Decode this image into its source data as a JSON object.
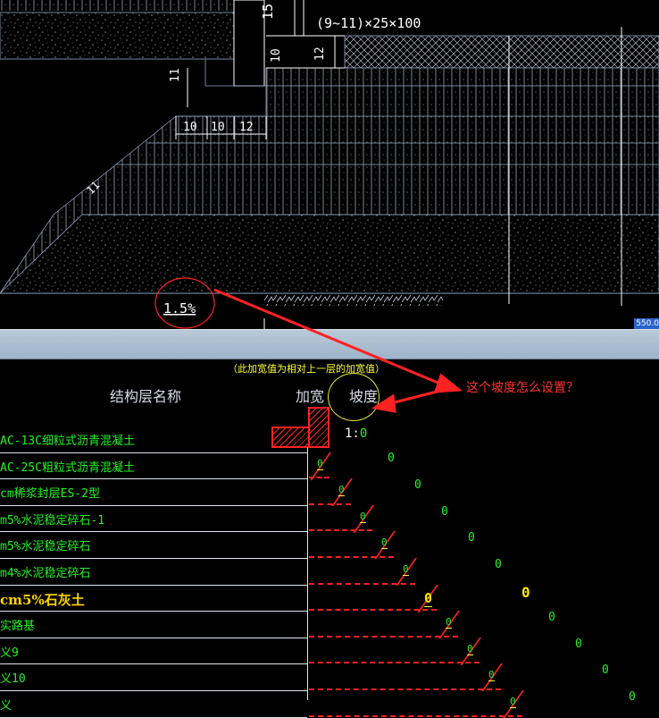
{
  "cad": {
    "dims": {
      "top_note": "(9~11)×25×100",
      "d15": "15",
      "d10": "10",
      "d12": "12",
      "d11a": "11",
      "w10a": "10",
      "w10b": "10",
      "w12": "12",
      "slope_dim": "11",
      "slope_label": "1.5%",
      "scale": "550.0"
    }
  },
  "panel": {
    "note": "（此加宽值为相对上一层的加宽值）",
    "col_name": "结构层名称",
    "col_widen": "加宽",
    "col_slope": "坡度",
    "slope_prefix": "1:",
    "slope_first_value": "0",
    "question": "这个坡度怎么设置？",
    "layers": [
      {
        "name": "AC-13C细粒式沥青混凝土",
        "widen": "",
        "value": ""
      },
      {
        "name": "AC-25C粗粒式沥青混凝土",
        "widen": "0",
        "value": "0"
      },
      {
        "name": "cm稀浆封层ES-2型",
        "widen": "0",
        "value": "0"
      },
      {
        "name": "m5%水泥稳定碎石-1",
        "widen": "0",
        "value": "0"
      },
      {
        "name": "m5%水泥稳定碎石",
        "widen": "0",
        "value": "0"
      },
      {
        "name": "m4%水泥稳定碎石",
        "widen": "0",
        "value": "0"
      },
      {
        "name": "cm5%石灰土",
        "widen": "0",
        "value": "0",
        "bold": true
      },
      {
        "name": "实路基",
        "widen": "0",
        "value": "0"
      },
      {
        "name": "义9",
        "widen": "0",
        "value": "0"
      },
      {
        "name": "义10",
        "widen": "0",
        "value": "0"
      },
      {
        "name": "义",
        "widen": "0",
        "value": "0"
      }
    ]
  },
  "colors": {
    "accent_red": "#ff2222",
    "value_green": "#28f028",
    "note_yellow": "#ffff33"
  }
}
